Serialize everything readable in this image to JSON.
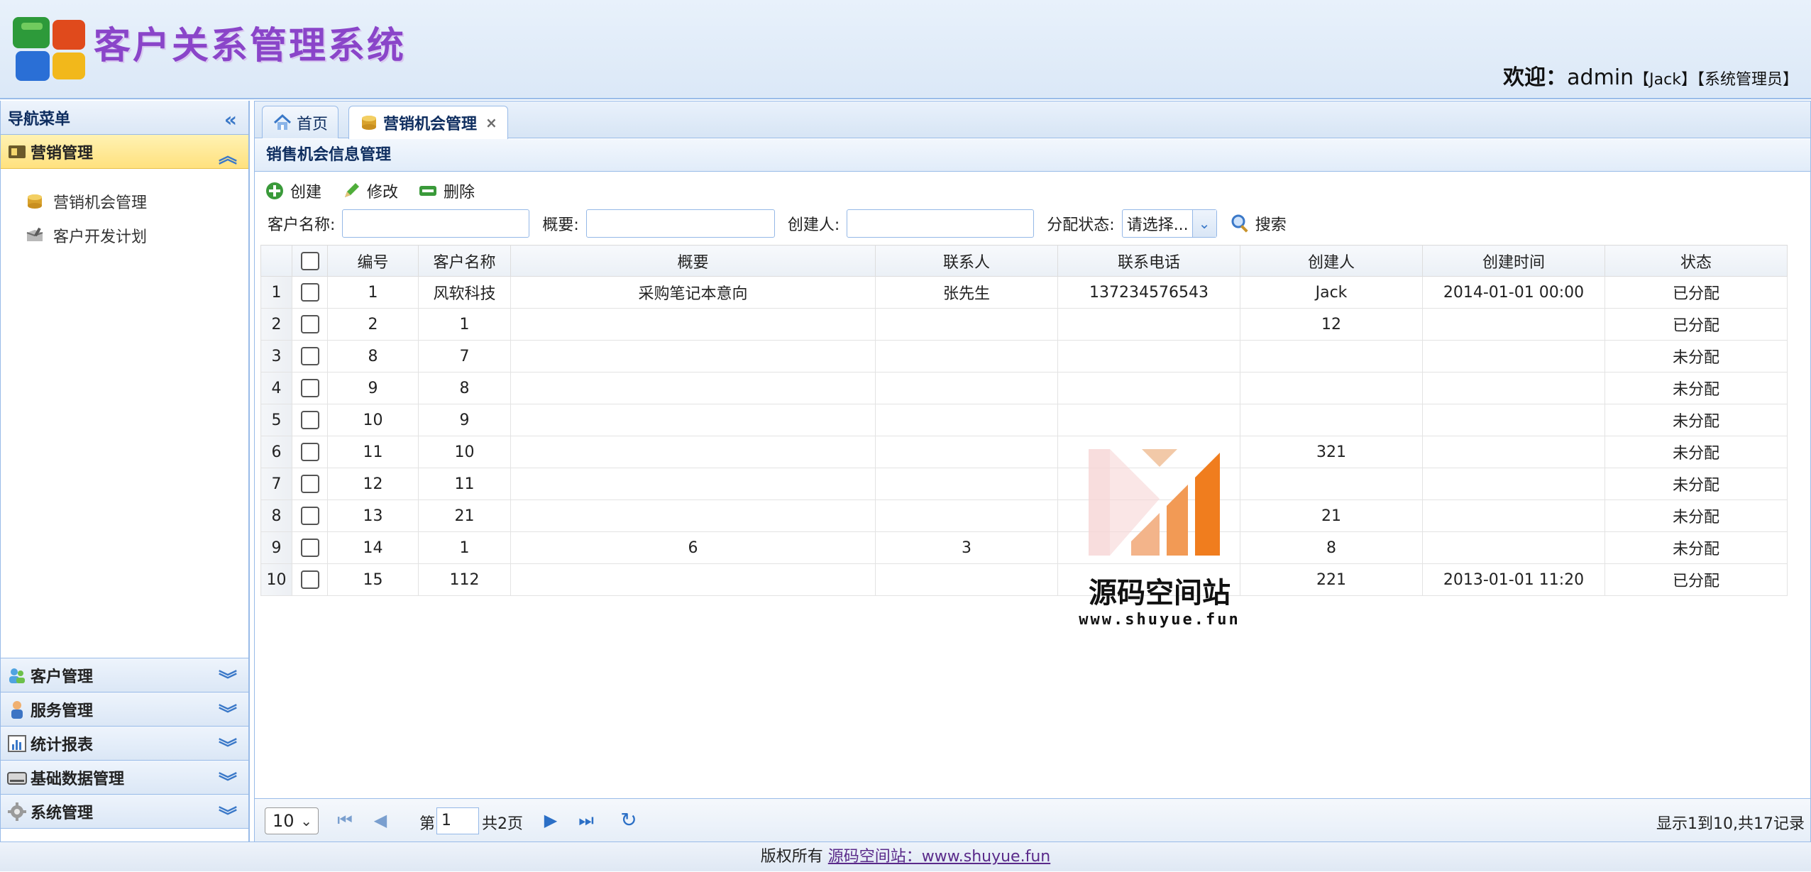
{
  "header": {
    "app_title": "客户关系管理系统",
    "welcome_label": "欢迎：",
    "user": "admin",
    "user_name": "【Jack】",
    "user_role": "【系统管理员】"
  },
  "sidebar": {
    "title": "导航菜单",
    "active_section": {
      "label": "营销管理",
      "items": [
        {
          "label": "营销机会管理",
          "icon": "coins-icon"
        },
        {
          "label": "客户开发计划",
          "icon": "plan-icon"
        }
      ]
    },
    "sections": [
      {
        "label": "客户管理",
        "icon": "customers-icon"
      },
      {
        "label": "服务管理",
        "icon": "service-icon"
      },
      {
        "label": "统计报表",
        "icon": "chart-icon"
      },
      {
        "label": "基础数据管理",
        "icon": "database-icon"
      },
      {
        "label": "系统管理",
        "icon": "gear-icon"
      }
    ]
  },
  "tabs": [
    {
      "label": "首页",
      "icon": "home-icon"
    },
    {
      "label": "营销机会管理",
      "icon": "coins-icon",
      "close": "×"
    }
  ],
  "panel_title": "销售机会信息管理",
  "toolbar": {
    "create": "创建",
    "edit": "修改",
    "delete": "删除"
  },
  "search": {
    "customer_label": "客户名称:",
    "summary_label": "概要:",
    "creator_label": "创建人:",
    "status_label": "分配状态:",
    "status_selected": "请选择...",
    "search_button": "搜索"
  },
  "grid": {
    "columns": [
      "编号",
      "客户名称",
      "概要",
      "联系人",
      "联系电话",
      "创建人",
      "创建时间",
      "状态"
    ],
    "rows": [
      {
        "rn": "1",
        "id": "1",
        "customer": "风软科技",
        "summary": "采购笔记本意向",
        "contact": "张先生",
        "phone": "137234576543",
        "creator": "Jack",
        "time": "2014-01-01 00:00",
        "status": "已分配"
      },
      {
        "rn": "2",
        "id": "2",
        "customer": "1",
        "summary": "",
        "contact": "",
        "phone": "",
        "creator": "12",
        "time": "",
        "status": "已分配"
      },
      {
        "rn": "3",
        "id": "8",
        "customer": "7",
        "summary": "",
        "contact": "",
        "phone": "",
        "creator": "",
        "time": "",
        "status": "未分配"
      },
      {
        "rn": "4",
        "id": "9",
        "customer": "8",
        "summary": "",
        "contact": "",
        "phone": "",
        "creator": "",
        "time": "",
        "status": "未分配"
      },
      {
        "rn": "5",
        "id": "10",
        "customer": "9",
        "summary": "",
        "contact": "",
        "phone": "",
        "creator": "",
        "time": "",
        "status": "未分配"
      },
      {
        "rn": "6",
        "id": "11",
        "customer": "10",
        "summary": "",
        "contact": "",
        "phone": "",
        "creator": "321",
        "time": "",
        "status": "未分配"
      },
      {
        "rn": "7",
        "id": "12",
        "customer": "11",
        "summary": "",
        "contact": "",
        "phone": "",
        "creator": "",
        "time": "",
        "status": "未分配"
      },
      {
        "rn": "8",
        "id": "13",
        "customer": "21",
        "summary": "",
        "contact": "",
        "phone": "",
        "creator": "21",
        "time": "",
        "status": "未分配"
      },
      {
        "rn": "9",
        "id": "14",
        "customer": "1",
        "summary": "6",
        "contact": "3",
        "phone": "4",
        "creator": "8",
        "time": "",
        "status": "未分配"
      },
      {
        "rn": "10",
        "id": "15",
        "customer": "112",
        "summary": "",
        "contact": "",
        "phone": "",
        "creator": "221",
        "time": "2013-01-01 11:20",
        "status": "已分配"
      }
    ]
  },
  "pager": {
    "page_size": "10",
    "page_prefix": "第",
    "page_current": "1",
    "page_total": "共2页",
    "info": "显示1到10,共17记录"
  },
  "watermark": {
    "title": "源码空间站",
    "url": "www.shuyue.fun"
  },
  "footer": {
    "text": "版权所有",
    "link": "源码空间站：www.shuyue.fun"
  }
}
